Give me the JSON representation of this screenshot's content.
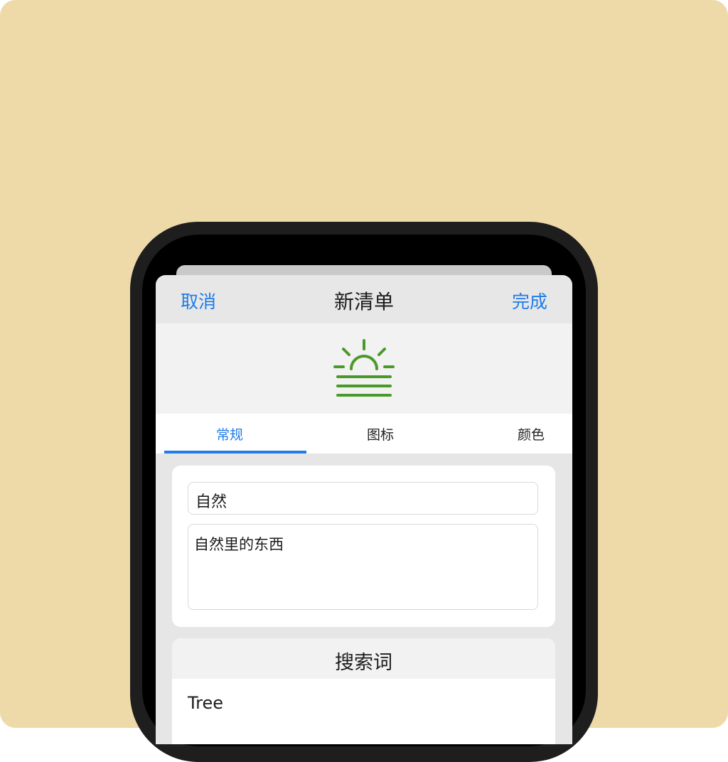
{
  "navbar": {
    "cancel_label": "取消",
    "title": "新清单",
    "done_label": "完成"
  },
  "list_icon": {
    "name": "sunrise-icon",
    "color": "#4A9A2A"
  },
  "tabs": [
    {
      "label": "常规",
      "selected": true
    },
    {
      "label": "图标",
      "selected": false
    },
    {
      "label": "颜色",
      "selected": false
    }
  ],
  "form": {
    "name_value": "自然",
    "description_value": "自然里的东西"
  },
  "search_terms": {
    "header": "搜索词",
    "items": [
      "Tree"
    ]
  },
  "colors": {
    "accent": "#1F7CE8",
    "background": "#EED9A8"
  }
}
